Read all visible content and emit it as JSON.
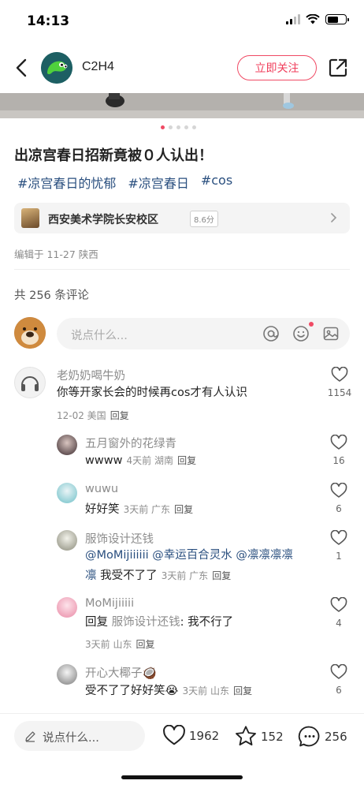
{
  "status_bar": {
    "time": "14:13"
  },
  "header": {
    "author": "C2H4",
    "follow_label": "立即关注"
  },
  "post": {
    "title": "出凉宫春日招新竟被０人认出！",
    "tags": [
      "#凉宫春日的忧郁",
      "#凉宫春日",
      "#cos"
    ],
    "location": {
      "name": "西安美术学院长安校区",
      "score": "8.6分"
    },
    "edit_info": "编辑于 11-27 陕西",
    "carousel": {
      "count": 5,
      "active_index": 0
    }
  },
  "comments_section": {
    "count_label": "共 256 条评论",
    "input_placeholder": "说点什么..."
  },
  "comments": [
    {
      "user": "老奶奶喝牛奶",
      "text": "你等开家长会的时候再cos才有人认识",
      "meta": "12-02 美国",
      "reply": "回复",
      "likes": "1154"
    }
  ],
  "replies": [
    {
      "user": "五月窗外的花绿青",
      "text": "wwww",
      "meta": "4天前 湖南",
      "reply": "回复",
      "likes": "16"
    },
    {
      "user": "wuwu",
      "text": "好好笑",
      "meta": "3天前 广东",
      "reply": "回复",
      "likes": "6"
    },
    {
      "user": "服饰设计还钱",
      "mention_line1": "@MoMijiiiiii @幸运百合灵水 @凛凛凛凛",
      "mention_line2": "凛",
      "text": " 我受不了了",
      "meta": "3天前 广东",
      "reply": "回复",
      "likes": "1"
    },
    {
      "user": "MoMijiiiii",
      "reply_prefix": "回复",
      "reply_to": "服饰设计还钱",
      "text": ": 我不行了",
      "meta": "3天前 山东",
      "reply": "回复",
      "likes": "4"
    },
    {
      "user": "开心大椰子🥥",
      "text": "受不了了好好笑😭",
      "meta": "3天前 山东",
      "reply": "回复",
      "likes": "6"
    }
  ],
  "bottom_bar": {
    "input_placeholder": "说点什么...",
    "likes": "1962",
    "stars": "152",
    "comments": "256"
  }
}
